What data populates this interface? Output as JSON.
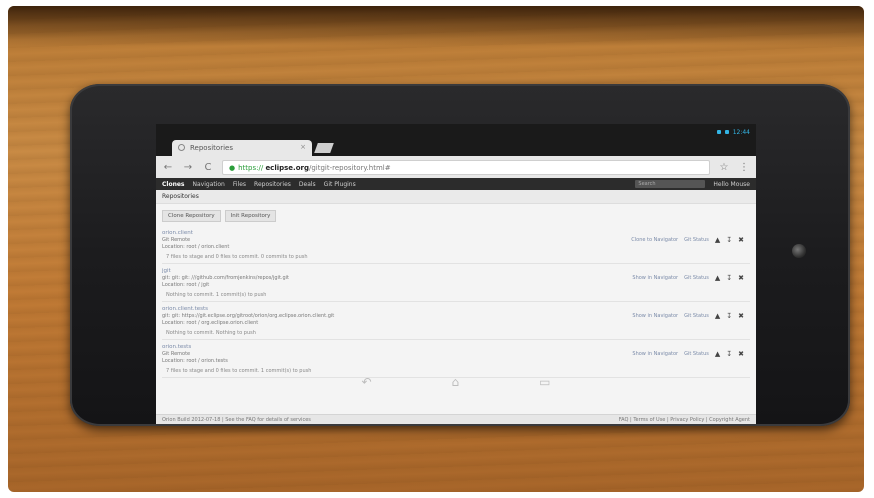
{
  "browser": {
    "tab_title": "Repositories",
    "tab_close": "×",
    "url_scheme": "https://",
    "url_domain_prefix": " ",
    "url_domain": "eclipse.org",
    "url_path": "/gitgit-repository.html#",
    "back_label": "←",
    "forward_label": "→",
    "reload_label": "C",
    "bookmark_label": "☆",
    "menu_label": "⋮"
  },
  "site_nav": {
    "items": [
      "Clones",
      "Navigation",
      "Files",
      "Repositories",
      "Deals",
      "Git Plugins"
    ],
    "search_placeholder": "Search",
    "user": "Hello Mouse"
  },
  "page": {
    "title": "Repositories",
    "tabs": [
      "Clone Repository",
      "Init Repository"
    ],
    "repos": [
      {
        "name": "orion.client",
        "lines": [
          "Git Remote",
          "Location: root / orion.client"
        ],
        "status": "7 files to stage and 0 files to commit.   0 commits to push",
        "manage": "Clone to Navigator"
      },
      {
        "name": "jgit",
        "lines": [
          "git: git: git: ///github.com/fromjenkins/repos/jgit.git",
          "Location: root / jgit"
        ],
        "status": "Nothing to commit.   1 commit(s) to push",
        "manage": "Show in Navigator"
      },
      {
        "name": "orion.client.tests",
        "lines": [
          "git: git: https://git.eclipse.org/gitroot/orion/org.eclipse.orion.client.git",
          "Location: root / org.eclipse.orion.client"
        ],
        "status": "Nothing to commit.   Nothing to push",
        "manage": "Show in Navigator"
      },
      {
        "name": "orion.tests",
        "lines": [
          "Git Remote",
          "Location: root / orion.tests"
        ],
        "status": "7 files to stage and 0 files to commit.   1 commit(s) to push",
        "manage": "Show in Navigator"
      }
    ],
    "status_label": "Git Status",
    "footer_left": "Orion Build 2012-07-18 | See the FAQ for details of services",
    "footer_right": "FAQ | Terms of Use | Privacy Policy | Copyright Agent"
  },
  "device": {
    "clock": "12:44"
  }
}
